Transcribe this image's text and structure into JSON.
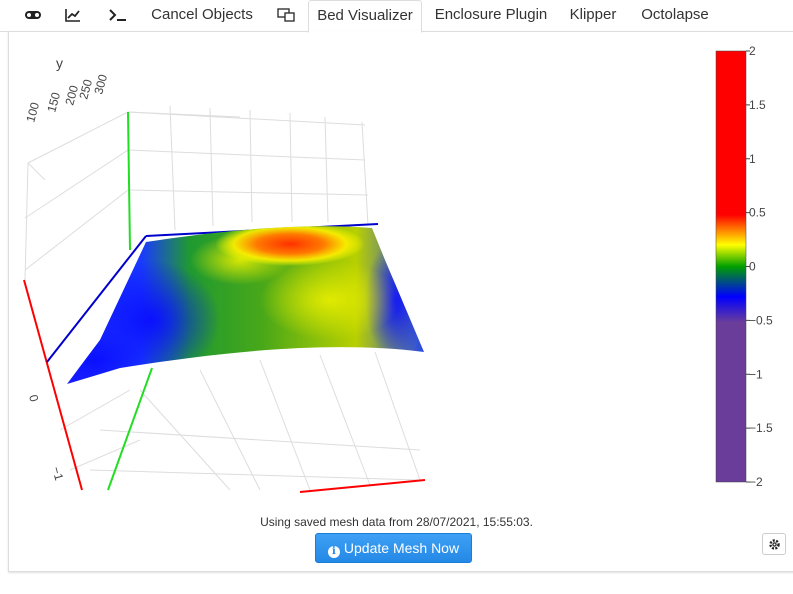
{
  "tabs": {
    "icons": [
      "gamepad-icon",
      "chart-icon",
      "terminal-icon"
    ],
    "cancel_objects": "Cancel Objects",
    "bed_visualizer": "Bed Visualizer",
    "enclosure_plugin": "Enclosure Plugin",
    "klipper": "Klipper",
    "octolapse": "Octolapse",
    "active": "Bed Visualizer"
  },
  "status_text": "Using saved mesh data from 28/07/2021, 15:55:03.",
  "update_button_label": "Update Mesh Now",
  "chart_data": {
    "type": "surface",
    "title": "",
    "axes": {
      "x": {
        "label": "",
        "ticks": [
          "0",
          "−1"
        ]
      },
      "y": {
        "label": "y",
        "ticks": [
          "100",
          "150",
          "200",
          "250",
          "300"
        ]
      },
      "z": {
        "label": "",
        "ticks": []
      }
    },
    "colorbar": {
      "ticks": [
        "2",
        "1.5",
        "1",
        "0.5",
        "0",
        "−0.5",
        "−1",
        "−1.5",
        "−2"
      ],
      "range": [
        -2,
        2
      ],
      "colorscale": [
        "#ff0000",
        "#ff0000",
        "#ffff00",
        "#00a000",
        "#0000ff",
        "#6a3d9a",
        "#6a3d9a"
      ]
    },
    "colors": {
      "x_axis": "#ff0000",
      "y_axis": "#00cc00",
      "z_axis": "#0000cc",
      "grid": "#d8d8d8"
    }
  }
}
